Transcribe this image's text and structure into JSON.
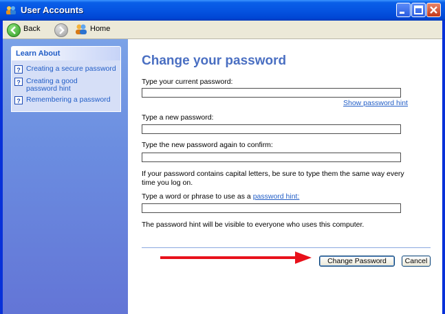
{
  "window": {
    "title": "User Accounts"
  },
  "nav": {
    "back_label": "Back",
    "home_label": "Home"
  },
  "sidebar": {
    "heading": "Learn About",
    "items": [
      {
        "label": "Creating a secure password",
        "icon": "help-icon"
      },
      {
        "label": "Creating a good password hint",
        "icon": "help-icon"
      },
      {
        "label": "Remembering a password",
        "icon": "help-icon"
      }
    ]
  },
  "main": {
    "title": "Change your password",
    "current_label": "Type your current password:",
    "current_value": "",
    "show_hint_link": "Show password hint",
    "new_label": "Type a new password:",
    "new_value": "",
    "confirm_label": "Type the new password again to confirm:",
    "confirm_value": "",
    "caps_note": "If your password contains capital letters, be sure to type them the same way every time you log on.",
    "hint_label_prefix": "Type a word or phrase to use as a",
    "hint_link": "password hint:",
    "hint_value": "",
    "hint_note": "The password hint will be visible to everyone who uses this computer.",
    "change_button": "Change Password",
    "cancel_button": "Cancel"
  },
  "colors": {
    "accent": "#215dc6",
    "titlebar": "#0554e1",
    "arrow": "#e8111b"
  }
}
